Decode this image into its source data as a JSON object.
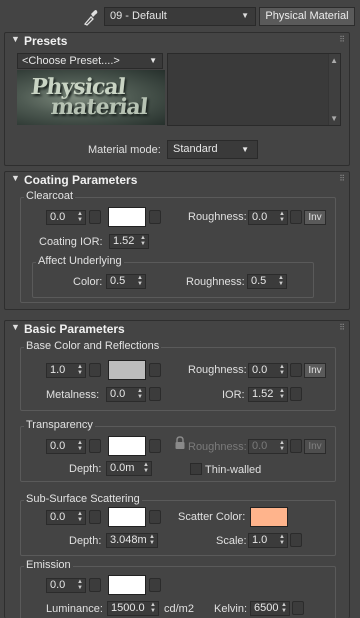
{
  "header": {
    "material_name": "09 - Default",
    "material_type": "Physical Material"
  },
  "colors": {
    "panel_bg": "#444444",
    "white_swatch": "#ffffff",
    "base_color_swatch": "#bdbdbd",
    "scatter_color_swatch": "#ffb48c"
  },
  "presets": {
    "title": "Presets",
    "dropdown_value": "<Choose Preset....>",
    "thumbnail_line1": "Physical",
    "thumbnail_line2": "material",
    "mode_label": "Material mode:",
    "mode_value": "Standard"
  },
  "coating": {
    "title": "Coating Parameters",
    "clearcoat": {
      "title": "Clearcoat",
      "weight": "0.0",
      "roughness_label": "Roughness:",
      "roughness": "0.0",
      "inv_label": "Inv",
      "ior_label": "Coating IOR:",
      "ior": "1.52"
    },
    "affect": {
      "title": "Affect Underlying",
      "color_label": "Color:",
      "color": "0.5",
      "roughness_label": "Roughness:",
      "roughness": "0.5"
    }
  },
  "basic": {
    "title": "Basic Parameters",
    "base": {
      "title": "Base Color and Reflections",
      "weight": "1.0",
      "roughness_label": "Roughness:",
      "roughness": "0.0",
      "inv_label": "Inv",
      "metalness_label": "Metalness:",
      "metalness": "0.0",
      "ior_label": "IOR:",
      "ior": "1.52"
    },
    "transparency": {
      "title": "Transparency",
      "weight": "0.0",
      "roughness_label": "Roughness:",
      "roughness": "0.0",
      "inv_label": "Inv",
      "depth_label": "Depth:",
      "depth": "0.0m",
      "thin_walled_label": "Thin-walled"
    },
    "sss": {
      "title": "Sub-Surface Scattering",
      "weight": "0.0",
      "scatter_label": "Scatter Color:",
      "depth_label": "Depth:",
      "depth": "3.048m",
      "scale_label": "Scale:",
      "scale": "1.0"
    },
    "emission": {
      "title": "Emission",
      "weight": "0.0",
      "luminance_label": "Luminance:",
      "luminance": "1500.0",
      "luminance_unit": "cd/m2",
      "kelvin_label": "Kelvin:",
      "kelvin": "6500"
    }
  }
}
